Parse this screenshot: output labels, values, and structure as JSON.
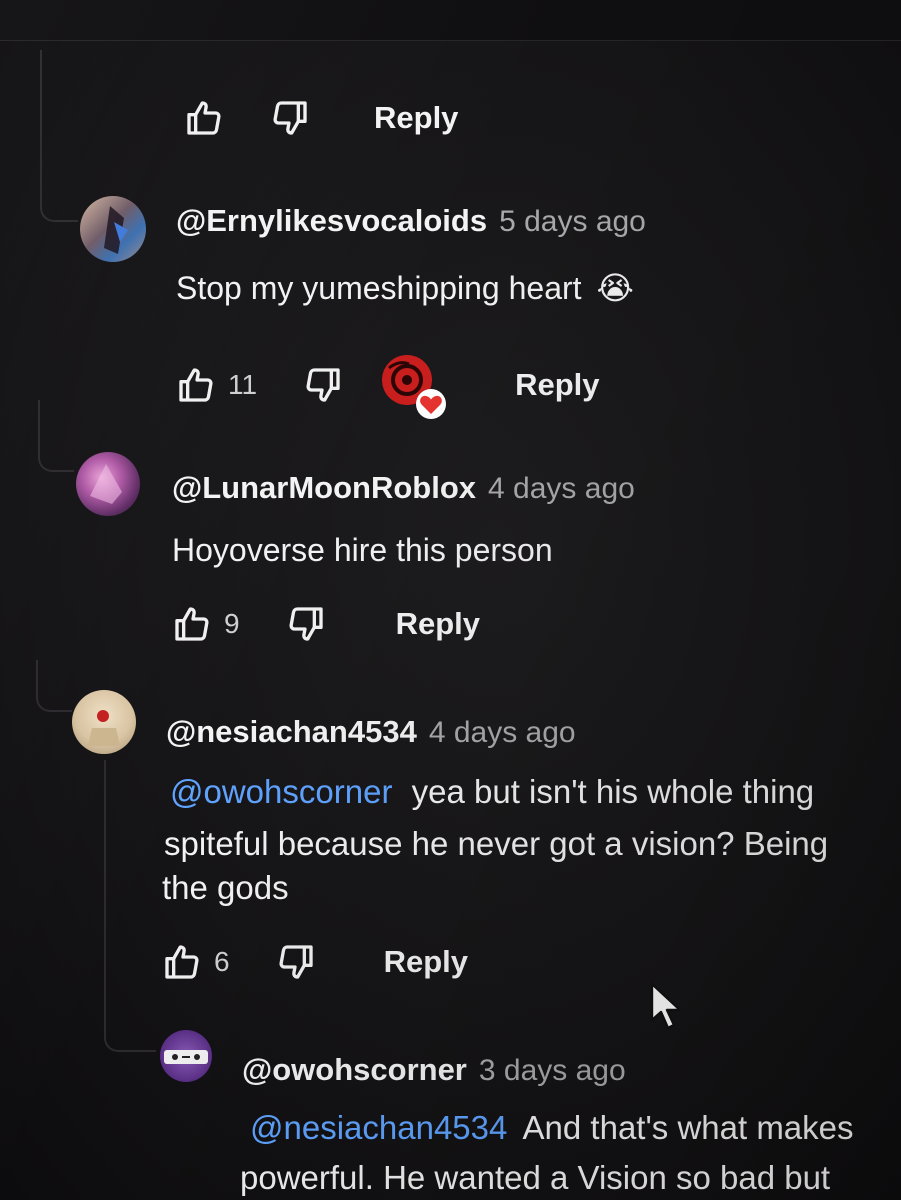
{
  "top_actions": {
    "reply_label": "Reply"
  },
  "comments": [
    {
      "handle": "@Ernylikesvocaloids",
      "time": "5 days ago",
      "text": "Stop my yumeshipping heart",
      "emoji": "😭",
      "likes": "11",
      "reply_label": "Reply",
      "creator_heart": true
    },
    {
      "handle": "@LunarMoonRoblox",
      "time": "4 days ago",
      "text": "Hoyoverse hire this person",
      "likes": "9",
      "reply_label": "Reply"
    },
    {
      "handle": "@nesiachan4534",
      "time": "4 days ago",
      "mention": "@owohscorner",
      "line1": "yea but isn't his whole thing",
      "line2": "spiteful because he never got a vision? Being",
      "line3": "the gods",
      "likes": "6",
      "reply_label": "Reply"
    },
    {
      "handle": "@owohscorner",
      "time": "3 days ago",
      "mention": "@nesiachan4534",
      "line1": "And that's what makes",
      "line2": "powerful. He wanted a Vision so bad but"
    }
  ],
  "colors": {
    "mention": "#5fa3ff",
    "background": "#161517",
    "heart": "#e6322e"
  }
}
